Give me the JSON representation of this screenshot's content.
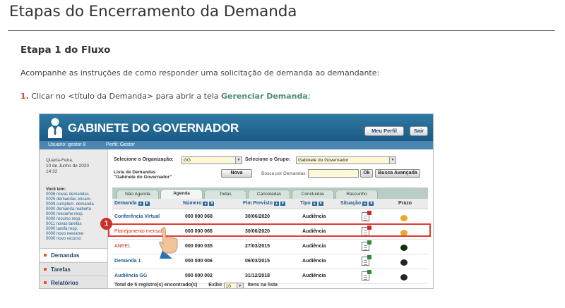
{
  "page": {
    "title": "Etapas do Encerramento da Demanda",
    "step_title": "Etapa 1 do Fluxo",
    "intro": "Acompanhe as instruções de como responder uma solicitação de demanda ao demandante:",
    "instruction": {
      "number": "1.",
      "text_before": " Clicar no <título da Demanda> para abrir a tela ",
      "link": "Gerenciar Demanda",
      "text_after": ";"
    }
  },
  "app": {
    "title": "GABINETE DO GOVERNADOR",
    "btn_profile": "Meu Perfil",
    "btn_exit": "Sair",
    "user_label": "Usuário: gestor 8",
    "profile_label": "Perfil: Gestor",
    "sidebar": {
      "date_line1": "Quarta-Feira,",
      "date_line2": "10 de Junho de 2020",
      "time": "14:32",
      "you_have": "Você tem:",
      "counters": [
        "0006 novas demandas",
        "0025 demandas encam.",
        "0009 complem. demanda",
        "0000 demanda reaberta",
        "0000 reexame resp.",
        "0000 recurso resp.",
        "0011 novas tarefas",
        "0000 tarefa resp.",
        "0000 novo reexame",
        "0000 novo recurso"
      ],
      "nav": [
        "Demandas",
        "Tarefas",
        "Relatórios"
      ]
    },
    "filters": {
      "org_label": "Selecione a Organização:",
      "org_value": "GG",
      "group_label": "Selecione o Grupo:",
      "group_value": "Gabinete do Governador",
      "list_title_1": "Lista de Demandas",
      "list_title_2": "\"Gabinete do Governador\"",
      "btn_new": "Nova",
      "search_label": "Busca por Demandas:",
      "btn_ok": "Ok",
      "btn_advanced": "Busca Avançada"
    },
    "tabs": [
      "Não Agenda",
      "Agenda",
      "Todas",
      "Canceladas",
      "Concluídas",
      "Rascunho"
    ],
    "columns": [
      "Demanda",
      "Número",
      "Fim Previsto",
      "Tipo",
      "Situação",
      "Prazo"
    ],
    "rows": [
      {
        "demanda": "Conferência Virtual",
        "numero": "000 000 068",
        "fim": "30/06/2020",
        "tipo": "Audiência",
        "status_color": "#cc2a22",
        "prazo_color": "#e9a92a",
        "style": "dem"
      },
      {
        "demanda": "Planejamento mensal",
        "numero": "000 000 066",
        "fim": "30/06/2020",
        "tipo": "Audiência",
        "status_color": "#cc2a22",
        "prazo_color": "#e9a92a",
        "style": "red"
      },
      {
        "demanda": "ANEEL",
        "numero": "000 000 035",
        "fim": "27/03/2015",
        "tipo": "Audiência",
        "status_color": "#2e8b3a",
        "prazo_color": "#1b2a1b",
        "style": "red"
      },
      {
        "demanda": "Demanda 1",
        "numero": "000 000 006",
        "fim": "06/03/2015",
        "tipo": "Audiência",
        "status_color": "#2e8b3a",
        "prazo_color": "#1b2a1b",
        "style": "dem"
      },
      {
        "demanda": "Audiência GG",
        "numero": "000 000 002",
        "fim": "31/12/2018",
        "tipo": "Audiência",
        "status_color": "#2e8b3a",
        "prazo_color": "#1b2a1b",
        "style": "dem"
      }
    ],
    "footer": {
      "total": "Total de 5 registro(s) encontrado(s)",
      "exibir": "Exibir",
      "per_page": "10",
      "suffix": "itens na lista"
    },
    "step_marker": "1"
  },
  "colors": {
    "header": "#1f6490",
    "highlight": "#e03a32",
    "step_number": "#c8502c",
    "link": "#4d8a76"
  }
}
